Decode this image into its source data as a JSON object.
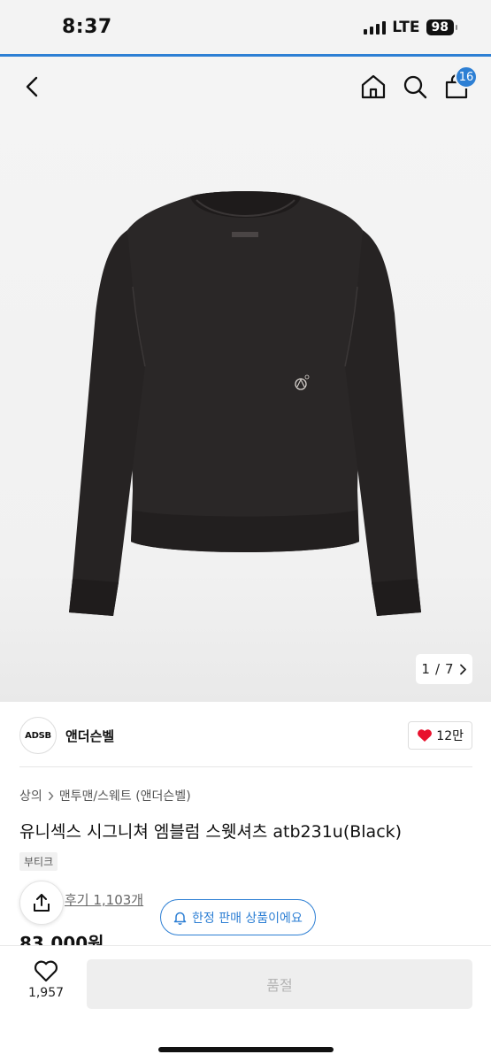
{
  "status": {
    "time": "8:37",
    "network": "LTE",
    "battery": "98"
  },
  "header": {
    "cart_count": "16"
  },
  "gallery": {
    "current": "1",
    "separator": "/",
    "total": "7"
  },
  "brand": {
    "logo_text": "ADSB",
    "name": "앤더슨벨",
    "likes": "12만"
  },
  "breadcrumb": {
    "level1": "상의",
    "level2": "맨투맨/스웨트 (앤더슨벨)"
  },
  "product": {
    "title": "유니섹스 시그니쳐 엠블럼 스웻셔츠 atb231u(Black)",
    "tag": "부티크",
    "reviews": "후기 1,103개",
    "limited_label": "한정 판매 상품이에요",
    "price": "83,000원"
  },
  "bottom": {
    "wish_count": "1,957",
    "action_label": "품절"
  },
  "colors": {
    "accent": "#2d7fd4",
    "heart": "#e8112d",
    "garment": "#2a2727"
  },
  "icons": [
    "back-icon",
    "home-icon",
    "search-icon",
    "bag-icon",
    "chevron-right-icon",
    "heart-icon",
    "share-icon",
    "bell-icon"
  ]
}
